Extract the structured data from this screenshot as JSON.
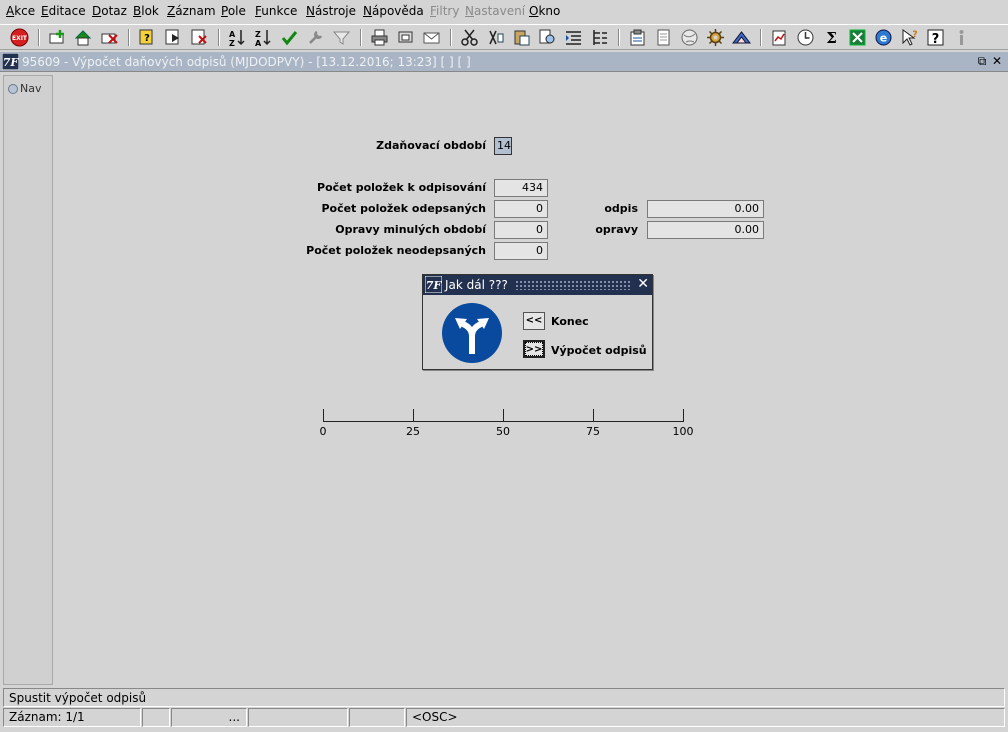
{
  "menu": {
    "items": [
      {
        "label": "Akce",
        "ul": "A",
        "rest": "kce"
      },
      {
        "label": "Editace",
        "ul": "E",
        "rest": "ditace"
      },
      {
        "label": "Dotaz",
        "ul": "D",
        "rest": "otaz"
      },
      {
        "label": "Blok",
        "ul": "B",
        "rest": "lok"
      },
      {
        "label": "Záznam",
        "ul": "Z",
        "rest": "áznam"
      },
      {
        "label": "Pole",
        "ul": "P",
        "rest": "ole"
      },
      {
        "label": "Funkce",
        "ul": "F",
        "rest": "unkce"
      },
      {
        "label": "Nástroje",
        "ul": "N",
        "rest": "ástroje"
      },
      {
        "label": "Nápověda",
        "ul": "N",
        "rest": "ápověda"
      },
      {
        "label": "Filtry",
        "ul": "F",
        "rest": "iltry",
        "disabled": true
      },
      {
        "label": "Nastavení",
        "ul": "N",
        "rest": "astavení",
        "disabled": true
      },
      {
        "label": "Okno",
        "ul": "O",
        "rest": "kno"
      }
    ]
  },
  "toolbar": {
    "exit_label": "EXIT"
  },
  "window": {
    "title": "95609 - Výpočet daňových odpisů (MJDODPVY) - [13.12.2016; 13:23]  [ ]  [ ]",
    "logo_text": "7F",
    "restore_icon": "⧉",
    "close_icon": "✕"
  },
  "nav": {
    "label": "Nav"
  },
  "form": {
    "period_label": "Zdaňovací období",
    "period_value": "14",
    "count_to_write_off_label": "Počet položek k odpisování",
    "count_to_write_off_value": "434",
    "count_written_off_label": "Počet položek odepsaných",
    "count_written_off_value": "0",
    "corrections_prev_label": "Opravy minulých období",
    "corrections_prev_value": "0",
    "count_not_written_off_label": "Počet položek neodepsaných",
    "count_not_written_off_value": "0",
    "odpis_label": "odpis",
    "odpis_value": "0.00",
    "opravy_label": "opravy",
    "opravy_value": "0.00"
  },
  "dialog": {
    "title": "Jak dál ???",
    "close_icon": "✕",
    "back_button": "<<",
    "back_label": "Konec",
    "next_button": ">>",
    "next_label": "Výpočet odpisů"
  },
  "progress": {
    "ticks": [
      "0",
      "25",
      "50",
      "75",
      "100"
    ],
    "value": 0
  },
  "hint": {
    "text": "Spustit výpočet odpisů"
  },
  "status": {
    "record": "Záznam: 1/1",
    "cell3": "...",
    "mode": "<OSC>"
  }
}
